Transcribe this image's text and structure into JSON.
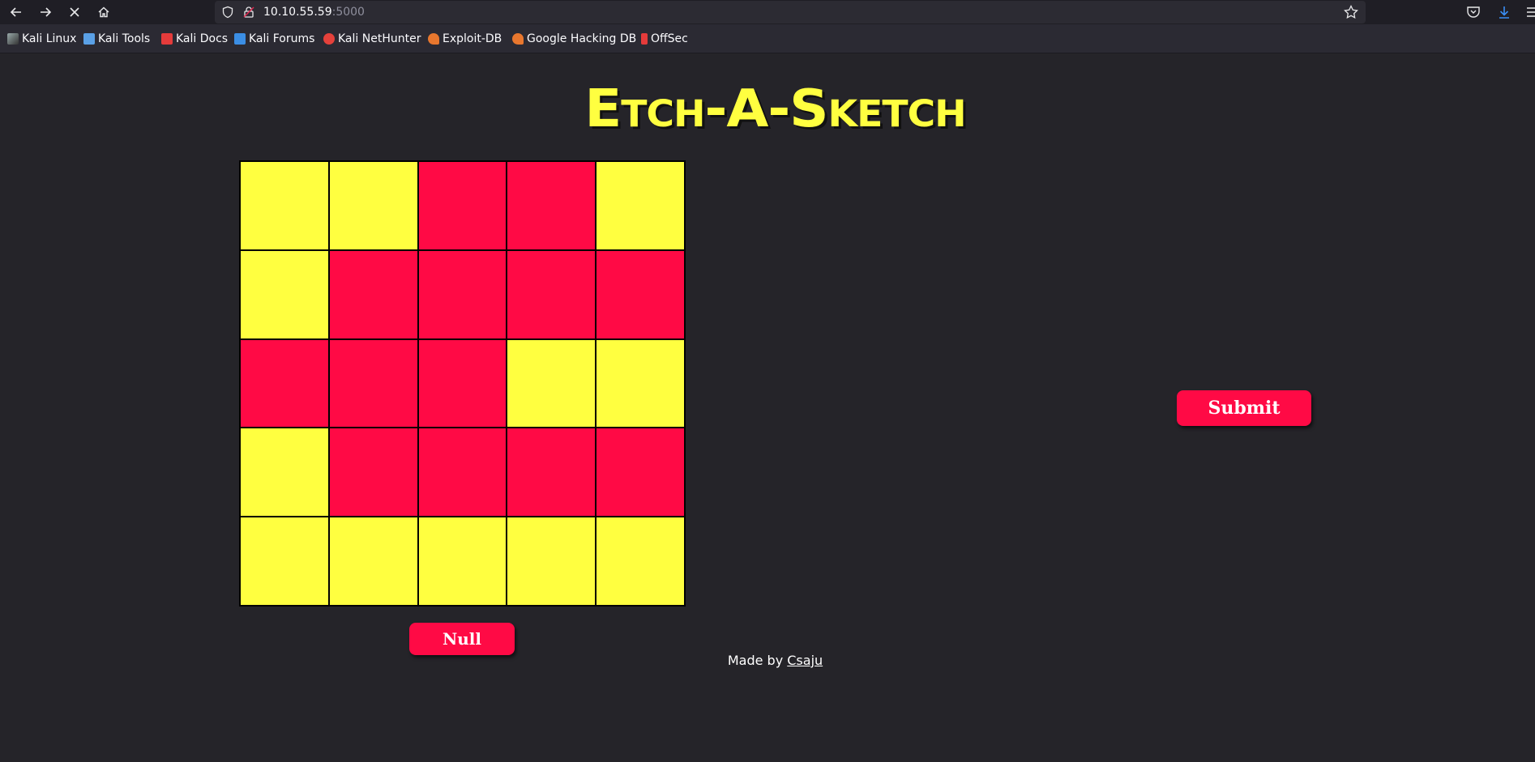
{
  "browser": {
    "url_host": "10.10.55.59",
    "url_port": ":5000",
    "bookmarks": [
      {
        "label": "Kali Linux",
        "icon": "kali-dragon-icon",
        "color": "#cfcfcf"
      },
      {
        "label": "Kali Tools",
        "icon": "kali-tools-icon",
        "color": "#5aa0e6"
      },
      {
        "label": "Kali Docs",
        "icon": "kali-docs-icon",
        "color": "#e53b3b"
      },
      {
        "label": "Kali Forums",
        "icon": "kali-forums-icon",
        "color": "#3b8ee5"
      },
      {
        "label": "Kali NetHunter",
        "icon": "kali-nethunter-icon",
        "color": "#e5413b"
      },
      {
        "label": "Exploit-DB",
        "icon": "exploit-db-icon",
        "color": "#e8772e"
      },
      {
        "label": "Google Hacking DB",
        "icon": "ghdb-icon",
        "color": "#e8772e"
      },
      {
        "label": "OffSec",
        "icon": "offsec-icon",
        "color": "#e53b3b"
      }
    ]
  },
  "page": {
    "title": "Etch-A-Sketch",
    "null_button": "Null",
    "submit_button": "Submit",
    "footer_prefix": "Made by ",
    "footer_link": "Csaju"
  },
  "colors": {
    "yellow": "#ffff40",
    "red": "#ff0a45",
    "background": "#252429"
  },
  "grid": {
    "rows": [
      [
        "yellow",
        "yellow",
        "red",
        "red",
        "yellow"
      ],
      [
        "yellow",
        "red",
        "red",
        "red",
        "red"
      ],
      [
        "red",
        "red",
        "red",
        "yellow",
        "yellow"
      ],
      [
        "yellow",
        "red",
        "red",
        "red",
        "red"
      ],
      [
        "yellow",
        "yellow",
        "yellow",
        "yellow",
        "yellow"
      ]
    ]
  }
}
